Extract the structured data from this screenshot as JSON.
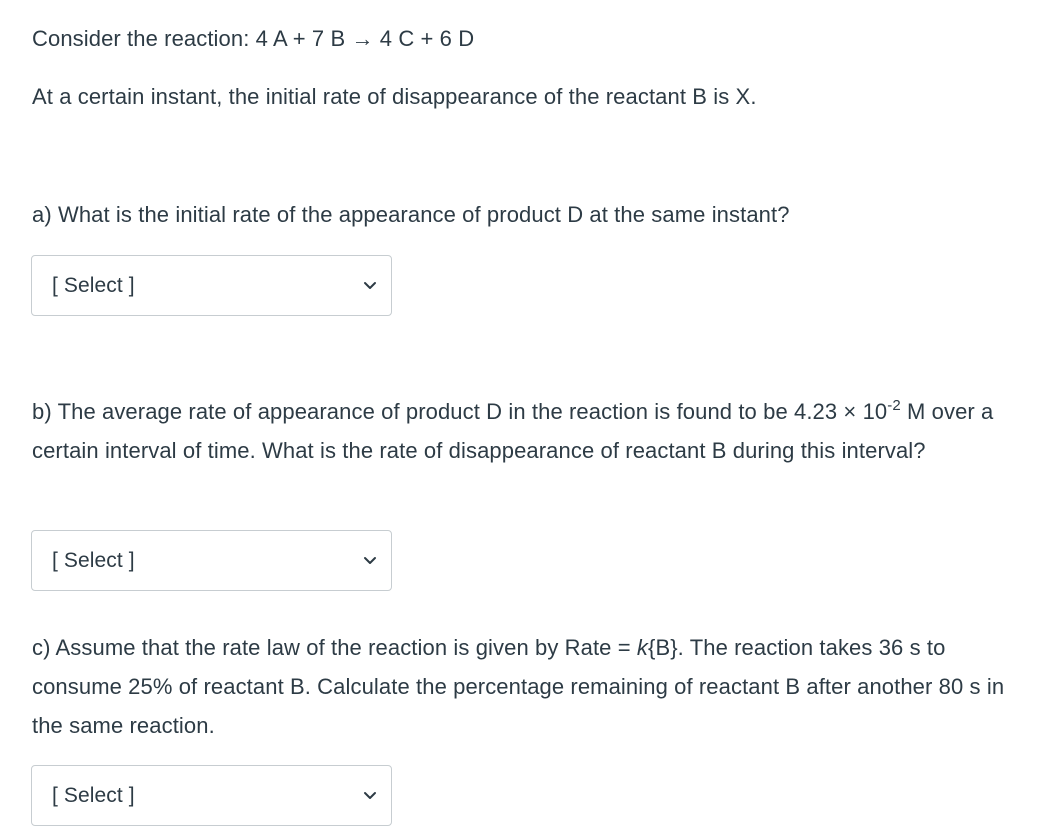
{
  "intro": {
    "reaction_prefix": "Consider the reaction: ",
    "reaction": "4 A + 7 B → 4 C + 6 D",
    "statement": "At a certain instant, the initial rate of disappearance of the reactant B is X."
  },
  "questions": [
    {
      "id": "a",
      "text": "a) What is the initial rate of the appearance of product D at the same instant?",
      "dropdown": {
        "selected": "[ Select ]"
      }
    },
    {
      "id": "b",
      "text_part1": "b) The average rate of appearance of product D in the reaction is found to be 4.23 × 10",
      "exponent": "-2",
      "text_part2": " M over a certain interval of time. What is the rate of disappearance of reactant B during this interval?",
      "dropdown": {
        "selected": "[ Select ]"
      }
    },
    {
      "id": "c",
      "text_part1": "c) Assume that the rate law of the reaction is given by Rate = ",
      "italic_k": "k",
      "text_part2": "{B}. The reaction takes 36 s to consume 25% of reactant B. Calculate the percentage remaining of reactant B after another 80 s in the same reaction.",
      "dropdown": {
        "selected": "[ Select ]"
      }
    }
  ],
  "icons": {
    "dropdown": "chevron-down-icon"
  }
}
